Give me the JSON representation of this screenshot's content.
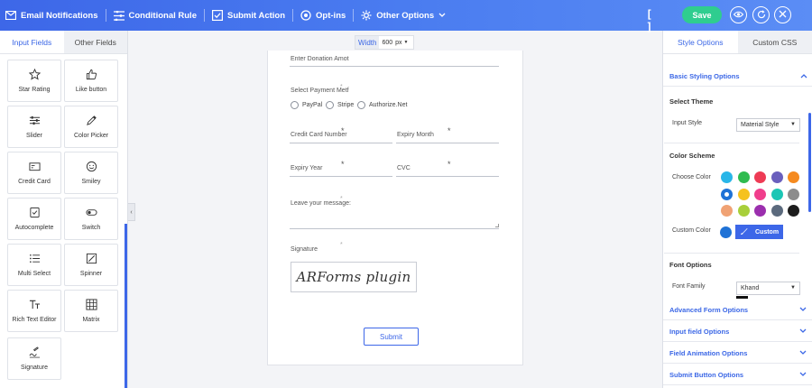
{
  "toolbar": {
    "items": [
      {
        "label": "Email Notifications",
        "icon": "mail-icon"
      },
      {
        "label": "Conditional Rule",
        "icon": "rules-icon"
      },
      {
        "label": "Submit Action",
        "icon": "check-icon"
      },
      {
        "label": "Opt-ins",
        "icon": "optins-icon"
      },
      {
        "label": "Other Options",
        "icon": "settings-icon"
      }
    ],
    "code_label": "[ ]",
    "save_label": "Save"
  },
  "left_panel": {
    "tabs": [
      "Input Fields",
      "Other Fields"
    ],
    "fields": [
      {
        "label": "Star Rating",
        "icon": "star-icon"
      },
      {
        "label": "Like button",
        "icon": "thumbs-up-icon"
      },
      {
        "label": "Slider",
        "icon": "slider-icon"
      },
      {
        "label": "Color Picker",
        "icon": "color-picker-icon"
      },
      {
        "label": "Credit Card",
        "icon": "credit-card-icon"
      },
      {
        "label": "Smiley",
        "icon": "smiley-icon"
      },
      {
        "label": "Autocomplete",
        "icon": "autocomplete-icon"
      },
      {
        "label": "Switch",
        "icon": "switch-icon"
      },
      {
        "label": "Multi Select",
        "icon": "list-icon"
      },
      {
        "label": "Spinner",
        "icon": "spinner-icon"
      },
      {
        "label": "Rich Text Editor",
        "icon": "text-icon"
      },
      {
        "label": "Matrix",
        "icon": "matrix-icon"
      },
      {
        "label": "Signature",
        "icon": "signature-icon"
      }
    ]
  },
  "canvas": {
    "width_label": "Width",
    "width_value": "600",
    "width_unit": "px",
    "donation_label": "Enter Donation Amot",
    "payment_label": "Select Payment Metf",
    "payment_options": [
      "PayPal",
      "Stripe",
      "Authorize.Net"
    ],
    "card_number_label": "Credit Card Number",
    "expiry_month_label": "Expiry Month",
    "expiry_year_label": "Expiry Year",
    "cvc_label": "CVC",
    "message_label": "Leave your message:",
    "signature_label": "Signature",
    "signature_value": "ARForms plugin",
    "submit_label": "Submit",
    "asterisk": "*"
  },
  "right_panel": {
    "tabs": [
      "Style Options",
      "Custom CSS"
    ],
    "basic_styling": "Basic Styling Options",
    "select_theme": "Select Theme",
    "input_style_label": "Input Style",
    "input_style_value": "Material Style",
    "color_scheme": "Color Scheme",
    "choose_color_label": "Choose Color",
    "colors": [
      "#29b6e8",
      "#2fbb4f",
      "#ee3b55",
      "#6a5fbd",
      "#f58a1f",
      "#1f72d6",
      "#f5c21f",
      "#f03e8c",
      "#1cc6b5",
      "#8c8c8c",
      "#f0a274",
      "#a8cf3a",
      "#9b2fae",
      "#5b6a7d",
      "#1d1d1d"
    ],
    "custom_color_label": "Custom Color",
    "custom_color_value": "#1f72d6",
    "custom_label": "Custom",
    "font_options": "Font Options",
    "font_family_label": "Font Family",
    "font_family_value": "Khand",
    "sections": [
      "Advanced Form Options",
      "Input field Options",
      "Field Animation Options",
      "Submit Button Options"
    ]
  }
}
